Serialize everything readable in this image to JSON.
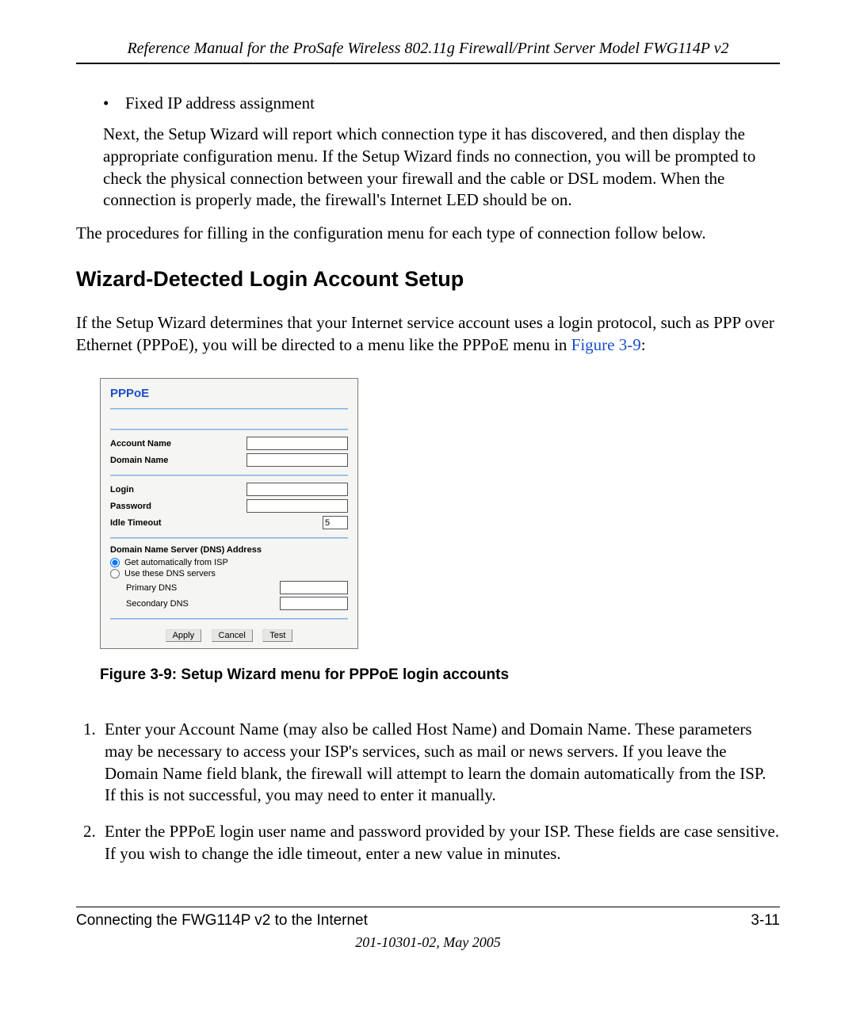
{
  "header": {
    "running_head": "Reference Manual for the ProSafe Wireless 802.11g  Firewall/Print Server Model FWG114P v2"
  },
  "intro": {
    "bullet": "Fixed IP address assignment",
    "followup": "Next, the Setup Wizard will report which connection type it has discovered, and then display the appropriate configuration menu. If the Setup Wizard finds no connection, you will be prompted to check the physical connection between your firewall and the cable or DSL modem. When the connection is properly made, the firewall's Internet LED should be on.",
    "lead_out": "The procedures for filling in the configuration menu for each type of connection follow below."
  },
  "section": {
    "title": "Wizard-Detected Login Account Setup",
    "para_pre": "If the Setup Wizard determines that your Internet service account uses a login protocol, such as PPP over Ethernet (PPPoE), you will be directed to a menu like the PPPoE menu in ",
    "fig_ref": "Figure 3-9",
    "para_post": ":"
  },
  "figure": {
    "title": "PPPoE",
    "account_name_label": "Account Name",
    "domain_name_label": "Domain Name",
    "login_label": "Login",
    "password_label": "Password",
    "idle_timeout_label": "Idle Timeout",
    "idle_timeout_value": "5",
    "dns_heading": "Domain Name Server (DNS) Address",
    "dns_auto": "Get automatically from ISP",
    "dns_manual": "Use these DNS servers",
    "primary_dns": "Primary DNS",
    "secondary_dns": "Secondary DNS",
    "btn_apply": "Apply",
    "btn_cancel": "Cancel",
    "btn_test": "Test",
    "caption": "Figure 3-9: Setup Wizard menu for PPPoE login accounts"
  },
  "steps": {
    "s1": "Enter your Account Name (may also be called Host Name) and Domain Name. These parameters may be necessary to access your ISP's services, such as mail or news servers. If you leave the Domain Name field blank, the firewall will attempt to learn the domain automatically from the ISP. If this is not successful, you may need to enter it manually.",
    "s2": "Enter the PPPoE login user name and password provided by your ISP. These fields are case sensitive. If you wish to change the idle timeout, enter a new value in minutes."
  },
  "footer": {
    "left": "Connecting the FWG114P v2 to the Internet",
    "right": "3-11",
    "docid": "201-10301-02, May 2005"
  }
}
